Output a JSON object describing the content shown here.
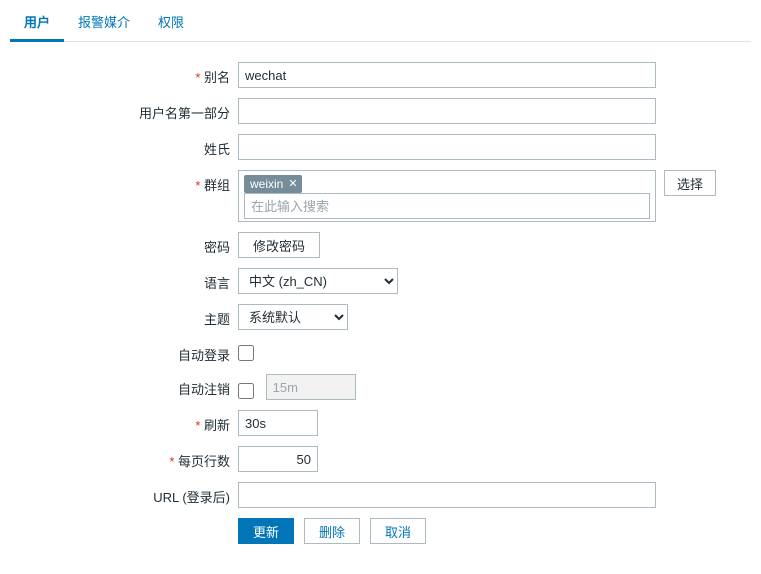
{
  "tabs": {
    "user": "用户",
    "media": "报警媒介",
    "perms": "权限"
  },
  "labels": {
    "alias": "别名",
    "name_first": "用户名第一部分",
    "surname": "姓氏",
    "groups": "群组",
    "password": "密码",
    "language": "语言",
    "theme": "主题",
    "autologin": "自动登录",
    "autologout": "自动注销",
    "refresh": "刷新",
    "rows": "每页行数",
    "url": "URL (登录后)"
  },
  "values": {
    "alias": "wechat",
    "name_first": "",
    "surname": "",
    "group_chip": "weixin",
    "group_placeholder": "在此输入搜索",
    "password_btn": "修改密码",
    "language": "中文 (zh_CN)",
    "theme": "系统默认",
    "autologout": "15m",
    "refresh": "30s",
    "rows": "50",
    "url": ""
  },
  "buttons": {
    "select": "选择",
    "update": "更新",
    "delete": "删除",
    "cancel": "取消"
  }
}
